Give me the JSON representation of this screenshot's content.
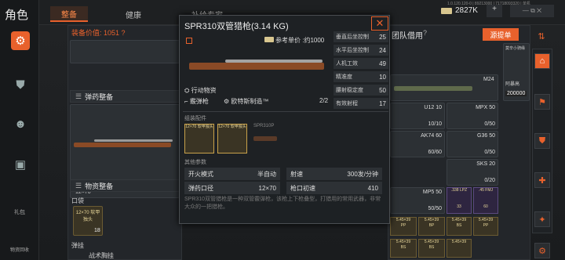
{
  "top": {
    "page_title": "角色",
    "tabs": [
      "整备",
      "健康",
      "补给专家"
    ],
    "version": "1.0.120.120-0 | 89213000 | 71718093320 | 单机",
    "currency": "2827K"
  },
  "left": {
    "equipment_value_label": "装备价值: 1051 ?",
    "ammo_header": "弹药整备",
    "gun_caption": "12×70",
    "supply_header": "物资整备",
    "pocket_label": "口袋",
    "pocket_item": "12×70 软甲独头",
    "pocket_count": "18",
    "vest_label": "弹挂",
    "vest_slot": "战术胸挂",
    "rail_labels": [
      "礼包",
      "物资回收"
    ]
  },
  "popup": {
    "title": "SPR310双管猎枪(3.14 KG)",
    "ref_price": "参考单价 :约1000",
    "stats": [
      {
        "name": "垂直后坐控制",
        "value": "25"
      },
      {
        "name": "水平后坐控制",
        "value": "24"
      },
      {
        "name": "人机工效",
        "value": "49"
      },
      {
        "name": "精准度",
        "value": "10"
      },
      {
        "name": "腰射稳定度",
        "value": "50"
      },
      {
        "name": "有效射程",
        "value": "17"
      }
    ],
    "tags": [
      "行动物资",
      "霰弹枪",
      "欧特斯制造™"
    ],
    "capacity": "2/2",
    "attach_header": "组装配件",
    "attach_items": [
      "12×70 软甲独头",
      "12×70 软甲独头",
      "SPR310P"
    ],
    "params_header": "其他参数",
    "params": [
      [
        "开火模式",
        "半自动"
      ],
      [
        "射速",
        "300发/分钟"
      ],
      [
        "弹药口径",
        "12×70"
      ],
      [
        "枪口初速",
        "410"
      ]
    ],
    "desc": "SPR310双管猎枪是一种双管霰弹枪，该枪上下枪叠型，打猎用的常用武器，非常大众的一把猎枪。"
  },
  "right": {
    "header": "团队借用",
    "filter": "源提单",
    "sort_label": "莫辛小骑缘",
    "m24": "M24",
    "cost": "200000",
    "label_cost": "阿暴高",
    "grid": [
      [
        "U12 10",
        "10/10"
      ],
      [
        "MPX 50",
        "0/50"
      ],
      [
        "AK74 60",
        "60/60"
      ],
      [
        "G36 50",
        "0/50"
      ],
      [
        "SKS 20",
        "0/20"
      ],
      [
        "MP5 50",
        "50/50"
      ]
    ],
    "ammo_tile": ".338 LPZ",
    "ammo_tile2": ".45 FMJ",
    "ammo_counts": [
      "33",
      "60"
    ],
    "ammo_rows": [
      "5.45×39",
      "5.45×39",
      "5.45×39",
      "5.45×39",
      "5.45×39",
      "5.45×39",
      "5.45×39"
    ],
    "ammo_tags": [
      "PP",
      "BP",
      "BS",
      "PP",
      "BS",
      "BS"
    ]
  }
}
